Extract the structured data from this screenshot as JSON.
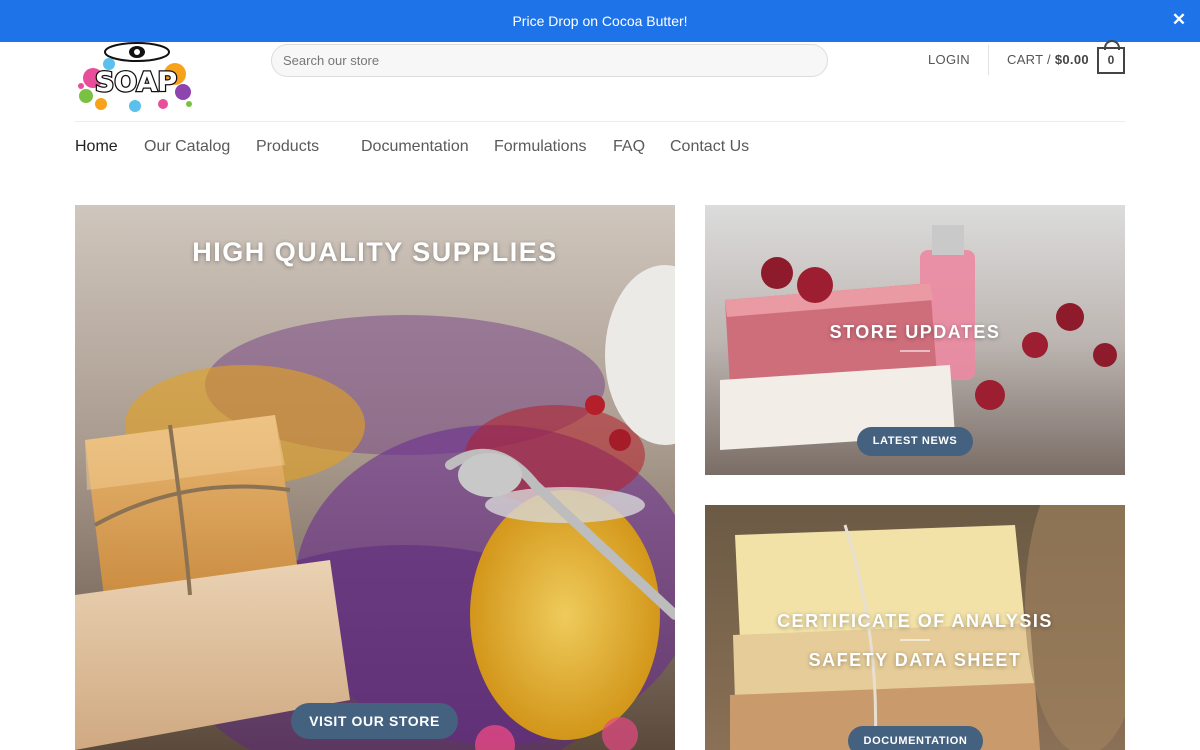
{
  "announcement": {
    "text": "Price Drop on Cocoa Butter!",
    "close": "✕"
  },
  "header": {
    "logo_text": "SOAP",
    "search_placeholder": "Search our store",
    "login": "LOGIN",
    "cart_label": "CART /",
    "cart_total": "$0.00",
    "cart_count": "0"
  },
  "nav": {
    "items": [
      "Home",
      "Our Catalog",
      "Products",
      "Documentation",
      "Formulations",
      "FAQ",
      "Contact Us"
    ]
  },
  "hero": {
    "title": "HIGH QUALITY SUPPLIES",
    "button": "VISIT OUR STORE"
  },
  "card_updates": {
    "title": "STORE UPDATES",
    "button": "LATEST NEWS"
  },
  "card_docs": {
    "line1": "CERTIFICATE OF ANALYSIS",
    "line2": "SAFETY DATA SHEET",
    "button": "DOCUMENTATION"
  },
  "colors": {
    "topbar": "#1e73e8",
    "button": "#44617f"
  }
}
